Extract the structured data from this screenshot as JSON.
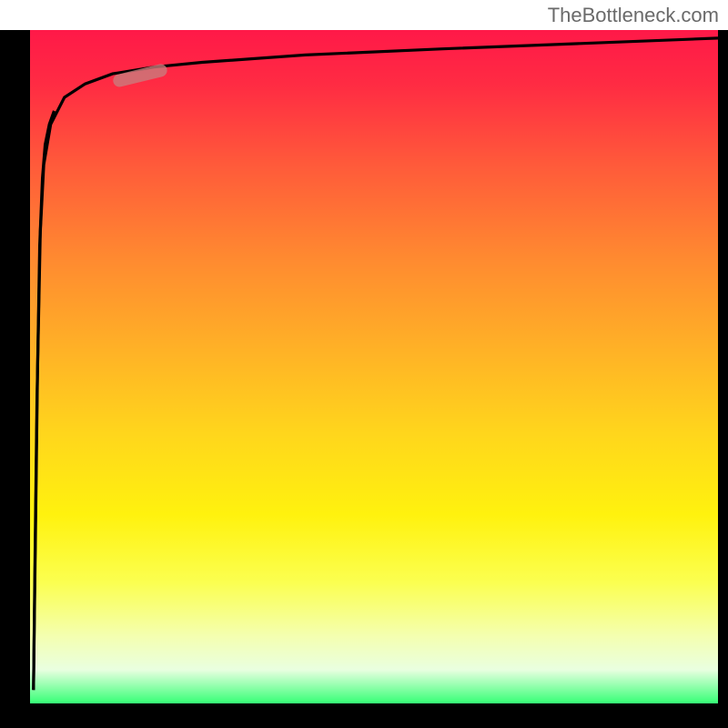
{
  "watermark": "TheBottleneck.com",
  "chart_data": {
    "type": "line",
    "title": "",
    "xlabel": "",
    "ylabel": "",
    "xlim": [
      0,
      100
    ],
    "ylim": [
      0,
      100
    ],
    "grid": false,
    "legend": false,
    "series": [
      {
        "name": "bottleneck-curve-right",
        "x": [
          0.5,
          0.7,
          1,
          1.5,
          2,
          3,
          5,
          8,
          12,
          18,
          25,
          40,
          60,
          80,
          100
        ],
        "y": [
          2,
          20,
          45,
          70,
          80,
          86,
          90,
          92,
          93.5,
          94.5,
          95.2,
          96.3,
          97.2,
          98,
          98.8
        ]
      },
      {
        "name": "bottleneck-curve-left",
        "x": [
          0.5,
          0.8,
          1.1,
          1.4,
          1.8,
          2.2,
          2.8,
          3.5
        ],
        "y": [
          2,
          25,
          50,
          68,
          78,
          83,
          86,
          88
        ]
      }
    ],
    "marker": {
      "x_range": [
        13,
        19
      ],
      "y_range": [
        92.5,
        94
      ],
      "color": "#c97e7e"
    },
    "gradient_background": {
      "top": "#ff1948",
      "middle": "#fff20e",
      "bottom": "#36ff76"
    }
  },
  "colors": {
    "frame": "#000000",
    "curve": "#000000",
    "marker": "#c97e7e",
    "watermark": "#6a6a6a"
  }
}
